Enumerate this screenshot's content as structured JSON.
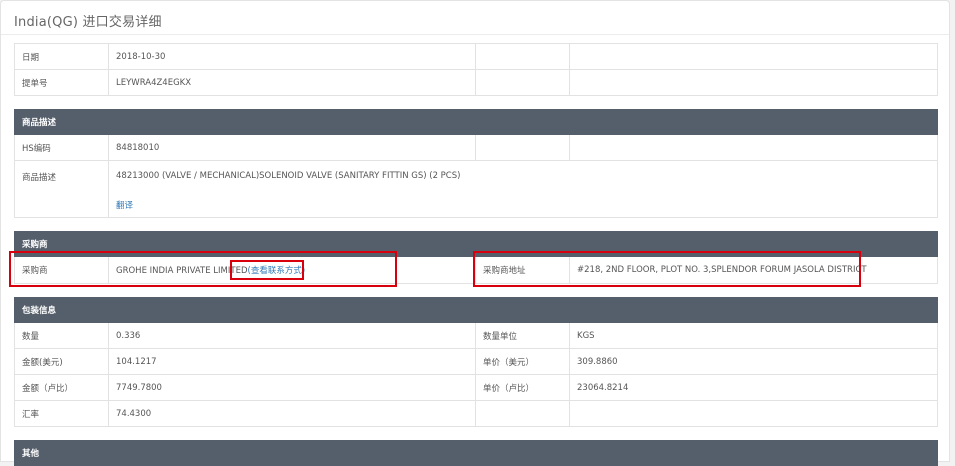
{
  "page_title": "India(QG) 进口交易详细",
  "basic": {
    "date_label": "日期",
    "date_value": "2018-10-30",
    "bill_label": "提单号",
    "bill_value": "LEYWRA4Z4EGKX"
  },
  "goods": {
    "header": "商品描述",
    "hs_label": "HS编码",
    "hs_value": "84818010",
    "desc_label": "商品描述",
    "desc_value": "48213000 (VALVE / MECHANICAL)SOLENOID VALVE (SANITARY FITTIN GS) (2 PCS)",
    "translate_link": "翻译"
  },
  "buyer": {
    "header": "采购商",
    "name_label": "采购商",
    "name_value": "GROHE INDIA PRIVATE LIMITED",
    "contact_link": "(查看联系方式)",
    "address_label": "采购商地址",
    "address_value": "#218, 2ND FLOOR, PLOT NO. 3,SPLENDOR FORUM JASOLA DISTRICT"
  },
  "packing": {
    "header": "包装信息",
    "qty_label": "数量",
    "qty_value": "0.336",
    "qty_unit_label": "数量单位",
    "qty_unit_value": "KGS",
    "amount_usd_label": "金额(美元)",
    "amount_usd_value": "104.1217",
    "unit_price_usd_label": "单价（美元）",
    "unit_price_usd_value": "309.8860",
    "amount_inr_label": "金额（卢比）",
    "amount_inr_value": "7749.7800",
    "unit_price_inr_label": "单价（卢比）",
    "unit_price_inr_value": "23064.8214",
    "rate_label": "汇率",
    "rate_value": "74.4300"
  },
  "other": {
    "header": "其他"
  },
  "colors": {
    "section_header_bg": "#555f6b",
    "link": "#337ab7",
    "highlight_border": "#d8000c"
  }
}
